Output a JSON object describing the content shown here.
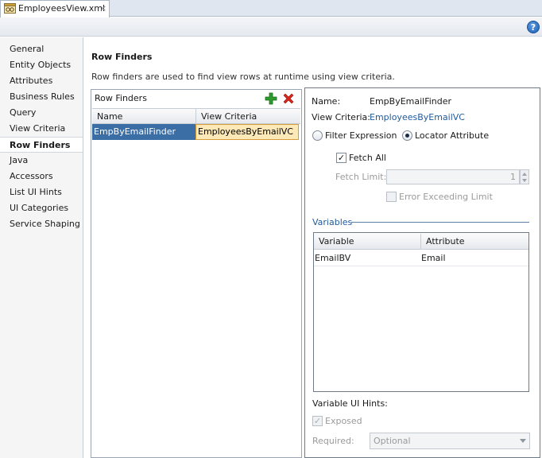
{
  "tab": {
    "label": "EmployeesView.xml",
    "close": "×"
  },
  "help": {
    "glyph": "?"
  },
  "nav": {
    "items": [
      {
        "label": "General"
      },
      {
        "label": "Entity Objects"
      },
      {
        "label": "Attributes"
      },
      {
        "label": "Business Rules"
      },
      {
        "label": "Query"
      },
      {
        "label": "View Criteria"
      },
      {
        "label": "Row Finders",
        "selected": true
      },
      {
        "label": "Java"
      },
      {
        "label": "Accessors"
      },
      {
        "label": "List UI Hints"
      },
      {
        "label": "UI Categories"
      },
      {
        "label": "Service Shaping"
      }
    ]
  },
  "main": {
    "title": "Row Finders",
    "description": "Row finders are used to find view rows at runtime using view criteria."
  },
  "row_finders": {
    "toolbar_label": "Row Finders",
    "columns": [
      "Name",
      "View Criteria"
    ],
    "rows": [
      {
        "name": "EmpByEmailFinder",
        "view_criteria": "EmployeesByEmailVC"
      }
    ]
  },
  "detail": {
    "name_label": "Name:",
    "name_value": "EmpByEmailFinder",
    "vc_label": "View Criteria:",
    "vc_value": "EmployeesByEmailVC",
    "radio_filter": "Filter Expression",
    "radio_locator": "Locator Attribute",
    "selected_radio": "Locator Attribute",
    "fetch_all_label": "Fetch All",
    "fetch_all_checked": true,
    "fetch_limit_label": "Fetch Limit:",
    "fetch_limit_value": "1",
    "error_exceeding_label": "Error Exceeding Limit",
    "error_exceeding_checked": false,
    "variables_label": "Variables",
    "variables_columns": [
      "Variable",
      "Attribute"
    ],
    "variables_rows": [
      {
        "variable": "EmailBV",
        "attribute": "Email"
      }
    ],
    "variable_ui_hints_label": "Variable UI Hints:",
    "exposed_label": "Exposed",
    "exposed_checked": true,
    "required_label": "Required:",
    "required_value": "Optional"
  },
  "colors": {
    "selection": "#3a6ea5",
    "focus_cell": "#fce9b7",
    "link_blue": "#1f5a9e",
    "add_green": "#2e9b2e",
    "delete_red": "#d9261c"
  }
}
